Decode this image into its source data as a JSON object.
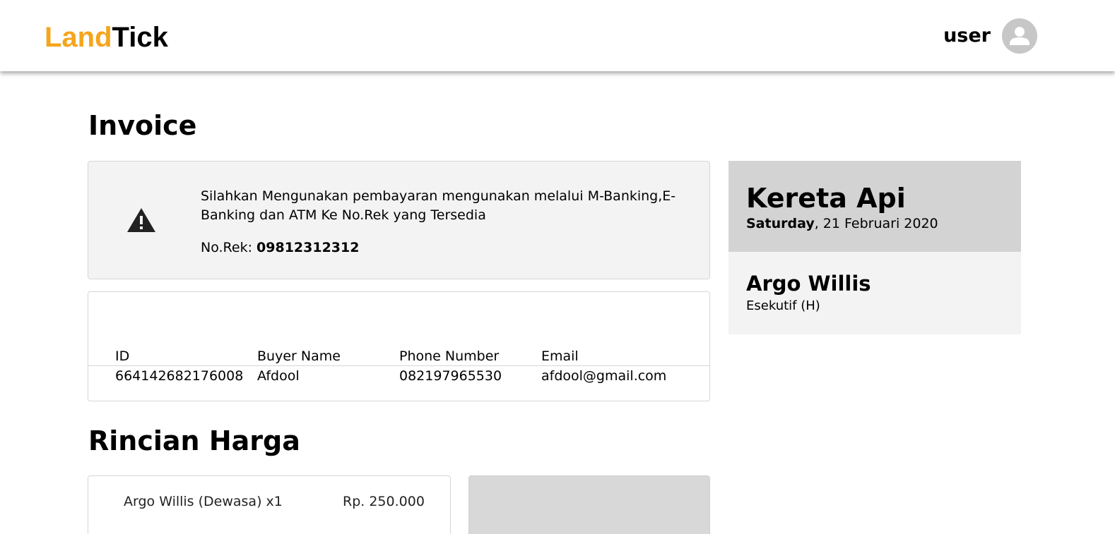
{
  "header": {
    "logo_part1": "Land",
    "logo_part2": "Tick",
    "user_name": "user",
    "avatar_icon": "user-avatar-icon",
    "accent_color": "#f5a51c"
  },
  "invoice": {
    "title": "Invoice",
    "notice": {
      "icon": "warning-icon",
      "message": "Silahkan Mengunakan pembayaran mengunakan melalui M-Banking,E-Banking dan ATM Ke No.Rek yang Tersedia",
      "rek_label": "No.Rek: ",
      "rek_number": "09812312312"
    },
    "buyer_table": {
      "headers": [
        "ID",
        "Buyer Name",
        "Phone Number",
        "Email"
      ],
      "row": [
        "664142682176008",
        "Afdool",
        "082197965530",
        "afdool@gmail.com"
      ]
    }
  },
  "train_card": {
    "type": "Kereta Api",
    "day": "Saturday",
    "date_rest": ", 21 Februari 2020",
    "train_name": "Argo Willis",
    "train_class": "Esekutif (H)"
  },
  "price": {
    "title": "Rincian Harga",
    "item_label": "Argo Willis (Dewasa) x1",
    "item_amount": "Rp. 250.000"
  }
}
